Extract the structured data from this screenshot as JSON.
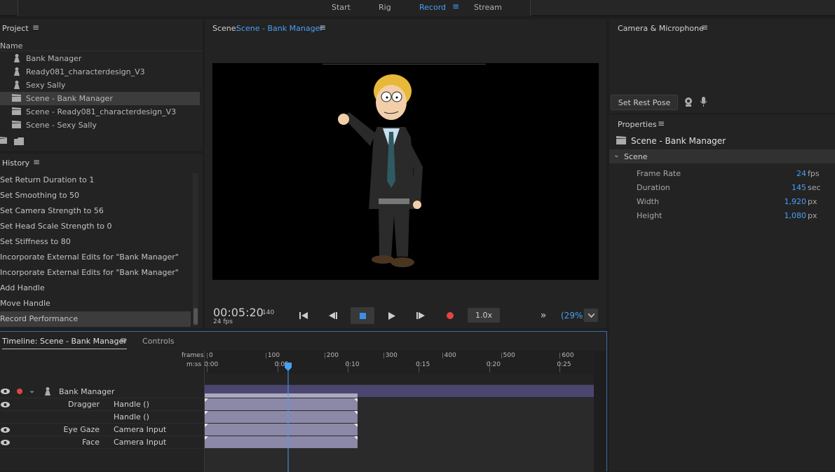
{
  "workspaces": {
    "start": "Start",
    "rig": "Rig",
    "record": "Record",
    "stream": "Stream"
  },
  "project": {
    "title": "Project",
    "column": "Name",
    "items": [
      {
        "label": "Bank Manager",
        "icon": "puppet-icon"
      },
      {
        "label": "Ready081_characterdesign_V3",
        "icon": "puppet-icon"
      },
      {
        "label": "Sexy Sally",
        "icon": "puppet-icon"
      },
      {
        "label": "Scene - Bank  Manager",
        "icon": "clapper-icon"
      },
      {
        "label": "Scene - Ready081_characterdesign_V3",
        "icon": "clapper-icon"
      },
      {
        "label": "Scene - Sexy  Sally",
        "icon": "clapper-icon"
      }
    ]
  },
  "history": {
    "title": "History",
    "items": [
      "Set Return Duration to 1",
      "Set Smoothing to 50",
      "Set Camera Strength to 56",
      "Set Head Scale Strength to 0",
      "Set Stiffness to 80",
      "Incorporate External Edits for \"Bank  Manager\"",
      "Incorporate External Edits for \"Bank  Manager\"",
      "Add Handle",
      "Move Handle",
      "Record Performance"
    ]
  },
  "scene": {
    "prefix": "Scene:",
    "name": "Scene - Bank  Manager"
  },
  "transport": {
    "timecode": "00:05:20",
    "frame": "140",
    "fps": "24 fps",
    "speed": "1.0x",
    "zoom": "(29%)"
  },
  "camera": {
    "title": "Camera & Microphone",
    "rest_pose": "Set Rest Pose"
  },
  "properties": {
    "title": "Properties",
    "item": "Scene - Bank  Manager",
    "section": "Scene",
    "rows": [
      {
        "label": "Frame Rate",
        "value": "24",
        "unit": "fps"
      },
      {
        "label": "Duration",
        "value": "145",
        "unit": "sec"
      },
      {
        "label": "Width",
        "value": "1,920",
        "unit": "px"
      },
      {
        "label": "Height",
        "value": "1,080",
        "unit": "px"
      }
    ]
  },
  "timeline": {
    "tab": "Timeline: Scene - Bank  Manager",
    "controls_tab": "Controls",
    "frames_label": "frames",
    "mss_label": "m:ss",
    "frame_ticks": [
      "0",
      "100",
      "200",
      "300",
      "400",
      "500",
      "600"
    ],
    "time_ticks": [
      "0:00",
      "0:05",
      "0:10",
      "0:15",
      "0:20",
      "0:25"
    ],
    "tracks": [
      {
        "name": "Bank  Manager",
        "param": ""
      },
      {
        "name": "Dragger",
        "param": "Handle ()"
      },
      {
        "name": "",
        "param": "Handle ()"
      },
      {
        "name": "Eye Gaze",
        "param": "Camera Input"
      },
      {
        "name": "Face",
        "param": "Camera Input"
      }
    ],
    "playhead_frame": 140,
    "clip_end_frame": 260
  },
  "colors": {
    "accent": "#4a9ff5",
    "record": "#e04545",
    "clip": "#8b88a8",
    "track_bar": "#4b4670"
  }
}
